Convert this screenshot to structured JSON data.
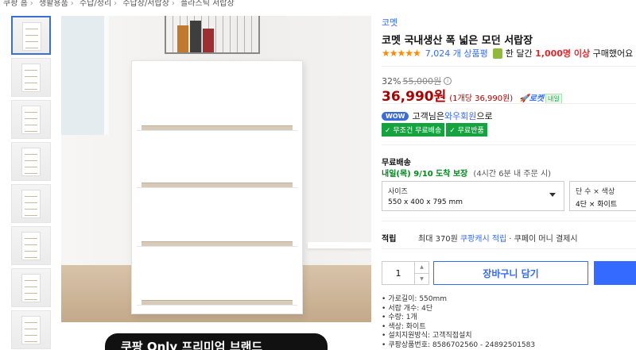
{
  "breadcrumb": [
    "쿠팡 홈",
    "생활용품",
    "수납/정리",
    "수납장/서랍장",
    "플라스틱 서랍장"
  ],
  "banner_text": "쿠팡 Only 프리미엄 브랜드",
  "product": {
    "brand": "코멧",
    "title": "코멧 국내생산 폭 넓은 모던 서랍장",
    "stars": "★★★★★",
    "review_count": "7,024 개 상품평",
    "buyers_prefix": "한 달간",
    "buyers_count": "1,000명 이상",
    "buyers_suffix": "구매했어요"
  },
  "price": {
    "discount_rate": "32%",
    "original": "55,000원",
    "sale": "36,990원",
    "unit": "(1개당 36,990원)",
    "rocket_label": "로켓",
    "rocket_badge": "내일"
  },
  "wow": {
    "pill": "WOW",
    "text_prefix": "고객님은",
    "link": "와우회원",
    "text_suffix": "으로",
    "benefits": [
      "✓ 무조건 무료배송",
      "✓ 무료반품"
    ]
  },
  "shipping": {
    "label": "무료배송",
    "date": "내일(목) 9/10",
    "guarantee": "도착 보장",
    "note": "(4시간 6분 내 주문 시)"
  },
  "options": {
    "size_label": "사이즈",
    "size_value": "550 x 400 x 795 mm",
    "tier_label": "단 수 × 색상",
    "tier_value": "4단 × 화이트"
  },
  "points": {
    "label": "적립",
    "prefix": "최대 370원",
    "link": "쿠팡캐시 적립",
    "suffix": "· 쿠페이 머니 결제시"
  },
  "purchase": {
    "quantity": "1",
    "cart_label": "장바구니 담기"
  },
  "specs": [
    "가로길이: 550mm",
    "서랍 개수: 4단",
    "수량: 1개",
    "색상: 화이트",
    "설치지원방식: 고객직접설치",
    "쿠팡상품번호: 8586702560 - 24892501583"
  ],
  "colors": {
    "accent": "#346aff",
    "price": "#ae0000",
    "benefit_green": "#14a33f",
    "star_orange": "#ff8a00"
  }
}
